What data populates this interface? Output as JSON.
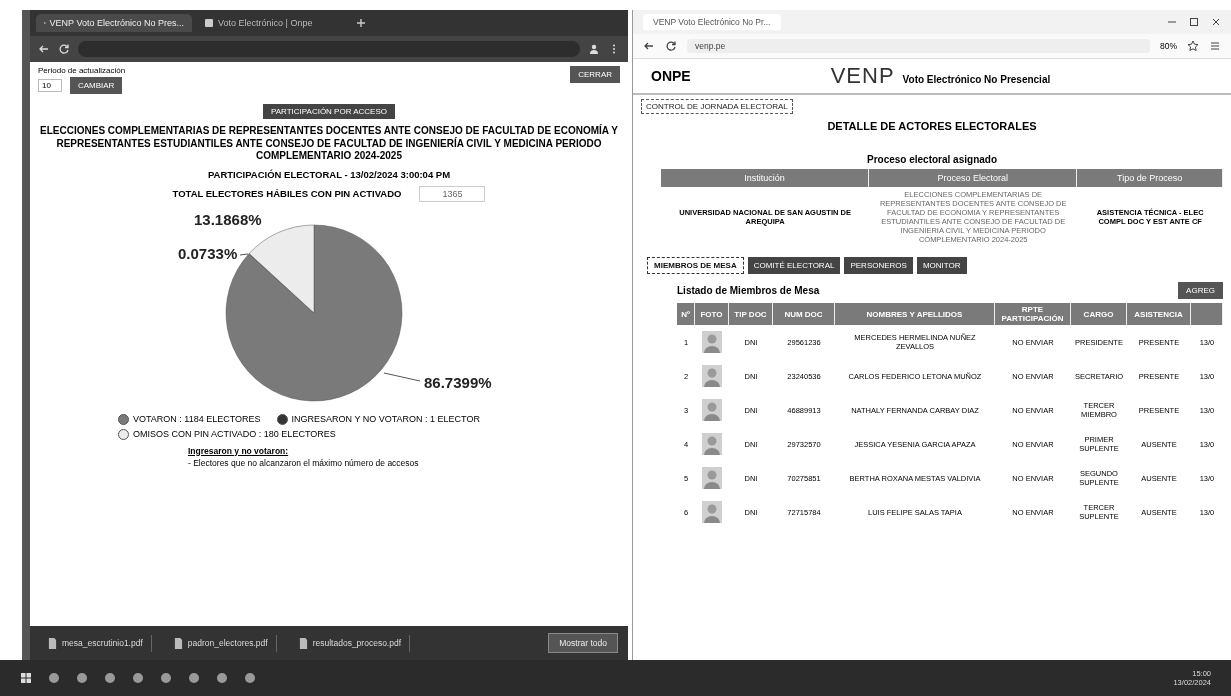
{
  "left_window": {
    "tabs": [
      {
        "title": "VENP Voto Electrónico No Pres...",
        "selected": true
      },
      {
        "title": "Voto Electrónico | Onpe",
        "selected": false
      }
    ],
    "page": {
      "refresh_label": "Periodo de actualización",
      "refresh_value": "10",
      "change_button": "CAMBIAR",
      "close_button": "CERRAR",
      "badge": "PARTICIPACIÓN POR ACCESO",
      "title": "ELECCIONES COMPLEMENTARIAS DE REPRESENTANTES DOCENTES ANTE CONSEJO DE FACULTAD DE ECONOMÍA Y REPRESENTANTES ESTUDIANTILES ANTE CONSEJO DE FACULTAD DE INGENIERÍA CIVIL Y MEDICINA PERIODO COMPLEMENTARIO 2024-2025",
      "subtitle": "PARTICIPACIÓN ELECTORAL - 13/02/2024 3:00:04 PM",
      "total_label": "TOTAL ELECTORES HÁBILES CON PIN ACTIVADO",
      "total_value": "1365",
      "chart_data": {
        "type": "pie",
        "categories": [
          "VOTARON",
          "INGRESARON Y NO VOTARON",
          "OMISOS CON PIN ACTIVADO"
        ],
        "values": [
          86.7399,
          0.0733,
          13.1868
        ],
        "value_labels": [
          "86.7399%",
          "0.0733%",
          "13.1868%"
        ]
      },
      "legend": [
        {
          "count": ": 1184 ELECTORES",
          "color": "#7a7a7a"
        },
        {
          "count": ": 1 ELECTOR",
          "color": "#333333"
        },
        {
          "count": ": 180 ELECTORES",
          "color": "#ececec"
        }
      ],
      "note_title": "Ingresaron y no votaron:",
      "note_text": "- Electores que no alcanzaron el máximo número de accesos"
    },
    "downloads": {
      "files": [
        {
          "name": "mesa_escrutinio1.pdf"
        },
        {
          "name": "padron_electores.pdf"
        },
        {
          "name": "resultados_proceso.pdf"
        }
      ],
      "show_all": "Mostrar todo"
    }
  },
  "right_window": {
    "tab": "VENP Voto Electrónico No Pr...",
    "url": "venp.pe",
    "zoom": "80%",
    "logo": "ONPE",
    "brand": "VENP",
    "tagline": "Voto Electrónico No Presencial",
    "back_link": "CONTROL DE JORNADA ELECTORAL",
    "heading": "DETALLE DE ACTORES ELECTORALES",
    "process_heading": "Proceso electoral asignado",
    "process_table": {
      "columns": [
        "Institución",
        "Proceso Electoral",
        "Tipo de Proceso"
      ],
      "row": [
        "UNIVERSIDAD NACIONAL DE SAN AGUSTIN DE AREQUIPA",
        "ELECCIONES COMPLEMENTARIAS DE REPRESENTANTES DOCENTES ANTE CONSEJO DE FACULTAD DE ECONOMIA Y REPRESENTANTES ESTUDIANTILES ANTE CONSEJO DE FACULTAD DE INGENIERIA CIVIL Y MEDICINA PERIODO COMPLEMENTARIO 2024-2025",
        "ASISTENCIA TÉCNICA - ELEC COMPL DOC Y EST ANTE CF"
      ]
    },
    "tabs": [
      {
        "label": "MIEMBROS DE MESA",
        "selected": true
      },
      {
        "label": "COMITÉ ELECTORAL",
        "selected": false
      },
      {
        "label": "PERSONEROS",
        "selected": false
      },
      {
        "label": "MONITOR",
        "selected": false
      }
    ],
    "list_title": "Listado de Miembros de Mesa",
    "add_button": "AGREG",
    "members": {
      "columns": [
        "Nº",
        "FOTO",
        "TIP DOC",
        "NUM DOC",
        "NOMBRES Y APELLIDOS",
        "RPTE PARTICIPACIÓN",
        "CARGO",
        "ASISTENCIA"
      ],
      "rows": [
        {
          "n": "1",
          "doc_type": "DNI",
          "doc": "29561236",
          "name": "MERCEDES HERMELINDA NUÑEZ ZEVALLOS",
          "rpte": "NO ENVIAR",
          "role": "PRESIDENTE",
          "attendance": "PRESENTE",
          "column_9": "13/0"
        },
        {
          "n": "2",
          "doc_type": "DNI",
          "doc": "23240536",
          "name": "CARLOS FEDERICO LETONA MUÑOZ",
          "rpte": "NO ENVIAR",
          "role": "SECRETARIO",
          "attendance": "PRESENTE",
          "column_9": "13/0"
        },
        {
          "n": "3",
          "doc_type": "DNI",
          "doc": "46889913",
          "name": "NATHALY FERNANDA CARBAY DIAZ",
          "rpte": "NO ENVIAR",
          "role": "TERCER MIEMBRO",
          "attendance": "PRESENTE",
          "column_9": "13/0"
        },
        {
          "n": "4",
          "doc_type": "DNI",
          "doc": "29732570",
          "name": "JESSICA YESENIA GARCIA APAZA",
          "rpte": "NO ENVIAR",
          "role": "PRIMER SUPLENTE",
          "attendance": "AUSENTE",
          "column_9": "13/0"
        },
        {
          "n": "5",
          "doc_type": "DNI",
          "doc": "70275851",
          "name": "BERTHA ROXANA MESTAS VALDIVIA",
          "rpte": "NO ENVIAR",
          "role": "SEGUNDO SUPLENTE",
          "attendance": "AUSENTE",
          "column_9": "13/0"
        },
        {
          "n": "6",
          "doc_type": "DNI",
          "doc": "72715784",
          "name": "LUIS FELIPE SALAS TAPIA",
          "rpte": "NO ENVIAR",
          "role": "TERCER SUPLENTE",
          "attendance": "AUSENTE",
          "column_9": "13/0"
        }
      ]
    }
  },
  "taskbar": {
    "time": "15:00",
    "date": "13/02/2024"
  }
}
